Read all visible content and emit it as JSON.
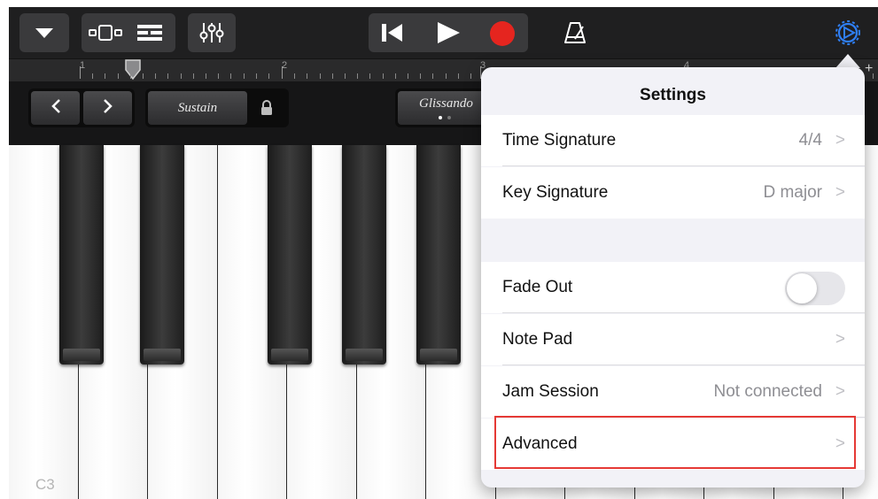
{
  "toolbar": {
    "view_menu_icon": "triangle-down-icon",
    "tracks_view_icon": "tracks-view-icon",
    "smart_controls_icon": "list-icon",
    "mixer_icon": "mixer-sliders-icon",
    "go_to_start_icon": "skip-back-icon",
    "play_icon": "play-icon",
    "record_icon": "record-icon",
    "metronome_icon": "metronome-icon",
    "settings_icon": "gear-icon",
    "record_color": "#e5251f",
    "settings_color": "#2f7ff5"
  },
  "ruler": {
    "markers": [
      "1",
      "2",
      "3",
      "4"
    ],
    "add_label": "+"
  },
  "controls": {
    "sustain_label": "Sustain",
    "glissando_label": "Glissando"
  },
  "keyboard": {
    "octave_label": "C3"
  },
  "settings": {
    "title": "Settings",
    "time_signature": {
      "label": "Time Signature",
      "value": "4/4",
      "chevron": ">"
    },
    "key_signature": {
      "label": "Key Signature",
      "value": "D major",
      "chevron": ">"
    },
    "fade_out": {
      "label": "Fade Out",
      "enabled": false
    },
    "note_pad": {
      "label": "Note Pad",
      "chevron": ">"
    },
    "jam_session": {
      "label": "Jam Session",
      "value": "Not connected",
      "chevron": ">"
    },
    "advanced": {
      "label": "Advanced",
      "chevron": ">"
    }
  }
}
